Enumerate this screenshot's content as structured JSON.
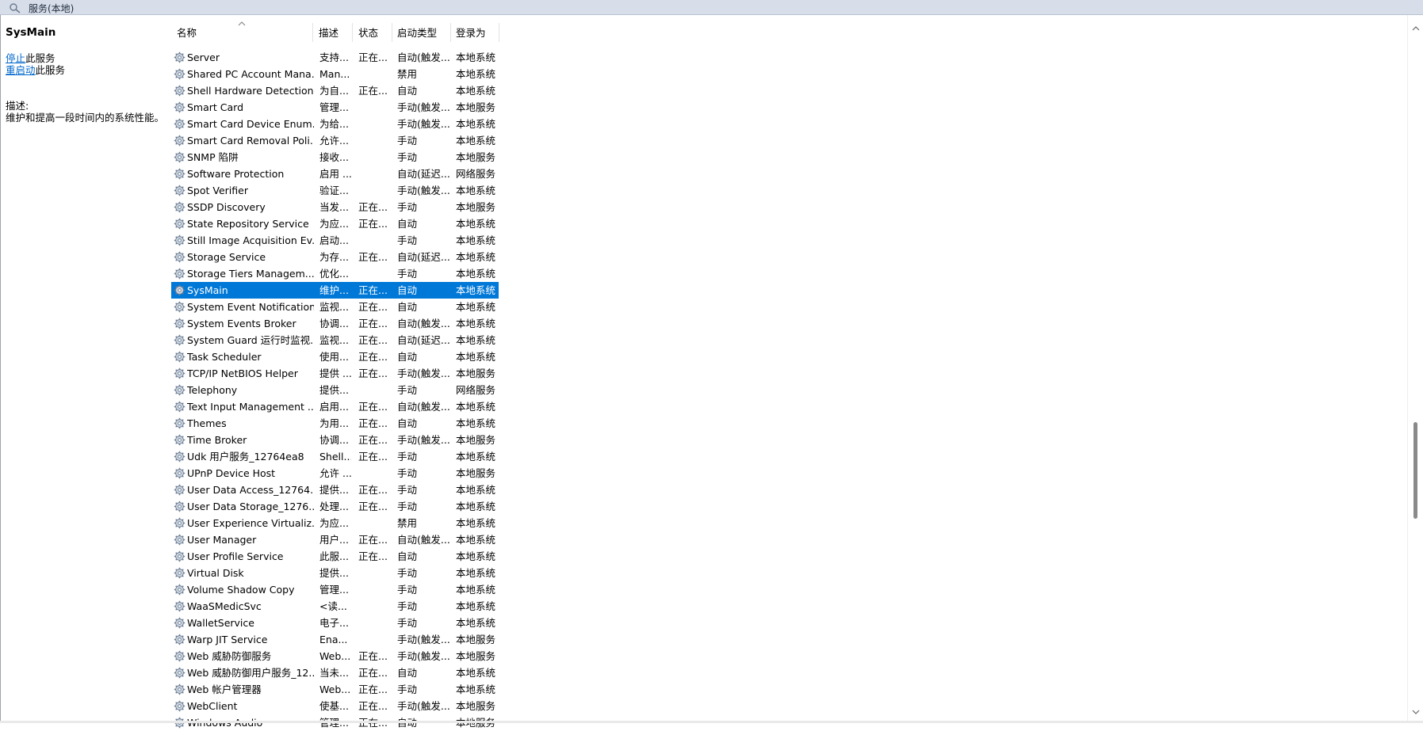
{
  "window": {
    "title": "服务(本地)",
    "icon": "services-icon"
  },
  "sidebar": {
    "service_name": "SysMain",
    "stop_link": "停止",
    "stop_suffix": "此服务",
    "restart_link": "重启动",
    "restart_suffix": "此服务",
    "desc_label": "描述:",
    "desc_text": "维护和提高一段时间内的系统性能。"
  },
  "table": {
    "columns": [
      "名称",
      "描述",
      "状态",
      "启动类型",
      "登录为"
    ],
    "sorted_column": "名称",
    "sort_direction": "ascending",
    "selected_row": "SysMain",
    "rows": [
      {
        "name": "Server",
        "desc": "支持...",
        "status": "正在...",
        "start": "自动(触发...",
        "logon": "本地系统"
      },
      {
        "name": "Shared PC Account Mana...",
        "desc": "Man...",
        "status": "",
        "start": "禁用",
        "logon": "本地系统"
      },
      {
        "name": "Shell Hardware Detection",
        "desc": "为自...",
        "status": "正在...",
        "start": "自动",
        "logon": "本地系统"
      },
      {
        "name": "Smart Card",
        "desc": "管理...",
        "status": "",
        "start": "手动(触发...",
        "logon": "本地服务"
      },
      {
        "name": "Smart Card Device Enum...",
        "desc": "为给...",
        "status": "",
        "start": "手动(触发...",
        "logon": "本地系统"
      },
      {
        "name": "Smart Card Removal Poli...",
        "desc": "允许...",
        "status": "",
        "start": "手动",
        "logon": "本地系统"
      },
      {
        "name": "SNMP 陷阱",
        "desc": "接收...",
        "status": "",
        "start": "手动",
        "logon": "本地服务"
      },
      {
        "name": "Software Protection",
        "desc": "启用 ...",
        "status": "",
        "start": "自动(延迟...",
        "logon": "网络服务"
      },
      {
        "name": "Spot Verifier",
        "desc": "验证...",
        "status": "",
        "start": "手动(触发...",
        "logon": "本地系统"
      },
      {
        "name": "SSDP Discovery",
        "desc": "当发...",
        "status": "正在...",
        "start": "手动",
        "logon": "本地服务"
      },
      {
        "name": "State Repository Service",
        "desc": "为应...",
        "status": "正在...",
        "start": "自动",
        "logon": "本地系统"
      },
      {
        "name": "Still Image Acquisition Ev...",
        "desc": "启动...",
        "status": "",
        "start": "手动",
        "logon": "本地系统"
      },
      {
        "name": "Storage Service",
        "desc": "为存...",
        "status": "正在...",
        "start": "自动(延迟...",
        "logon": "本地系统"
      },
      {
        "name": "Storage Tiers Managem...",
        "desc": "优化...",
        "status": "",
        "start": "手动",
        "logon": "本地系统"
      },
      {
        "name": "SysMain",
        "desc": "维护...",
        "status": "正在...",
        "start": "自动",
        "logon": "本地系统"
      },
      {
        "name": "System Event Notification...",
        "desc": "监视...",
        "status": "正在...",
        "start": "自动",
        "logon": "本地系统"
      },
      {
        "name": "System Events Broker",
        "desc": "协调...",
        "status": "正在...",
        "start": "自动(触发...",
        "logon": "本地系统"
      },
      {
        "name": "System Guard 运行时监视...",
        "desc": "监视...",
        "status": "正在...",
        "start": "自动(延迟...",
        "logon": "本地系统"
      },
      {
        "name": "Task Scheduler",
        "desc": "使用...",
        "status": "正在...",
        "start": "自动",
        "logon": "本地系统"
      },
      {
        "name": "TCP/IP NetBIOS Helper",
        "desc": "提供 ...",
        "status": "正在...",
        "start": "手动(触发...",
        "logon": "本地服务"
      },
      {
        "name": "Telephony",
        "desc": "提供...",
        "status": "",
        "start": "手动",
        "logon": "网络服务"
      },
      {
        "name": "Text Input Management ...",
        "desc": "启用...",
        "status": "正在...",
        "start": "自动(触发...",
        "logon": "本地系统"
      },
      {
        "name": "Themes",
        "desc": "为用...",
        "status": "正在...",
        "start": "自动",
        "logon": "本地系统"
      },
      {
        "name": "Time Broker",
        "desc": "协调...",
        "status": "正在...",
        "start": "手动(触发...",
        "logon": "本地服务"
      },
      {
        "name": "Udk 用户服务_12764ea8",
        "desc": "Shell...",
        "status": "正在...",
        "start": "手动",
        "logon": "本地系统"
      },
      {
        "name": "UPnP Device Host",
        "desc": "允许 ...",
        "status": "",
        "start": "手动",
        "logon": "本地服务"
      },
      {
        "name": "User Data Access_12764...",
        "desc": "提供...",
        "status": "正在...",
        "start": "手动",
        "logon": "本地系统"
      },
      {
        "name": "User Data Storage_1276...",
        "desc": "处理...",
        "status": "正在...",
        "start": "手动",
        "logon": "本地系统"
      },
      {
        "name": "User Experience Virtualiz...",
        "desc": "为应...",
        "status": "",
        "start": "禁用",
        "logon": "本地系统"
      },
      {
        "name": "User Manager",
        "desc": "用户...",
        "status": "正在...",
        "start": "自动(触发...",
        "logon": "本地系统"
      },
      {
        "name": "User Profile Service",
        "desc": "此服...",
        "status": "正在...",
        "start": "自动",
        "logon": "本地系统"
      },
      {
        "name": "Virtual Disk",
        "desc": "提供...",
        "status": "",
        "start": "手动",
        "logon": "本地系统"
      },
      {
        "name": "Volume Shadow Copy",
        "desc": "管理...",
        "status": "",
        "start": "手动",
        "logon": "本地系统"
      },
      {
        "name": "WaaSMedicSvc",
        "desc": "<读...",
        "status": "",
        "start": "手动",
        "logon": "本地系统"
      },
      {
        "name": "WalletService",
        "desc": "电子...",
        "status": "",
        "start": "手动",
        "logon": "本地系统"
      },
      {
        "name": "Warp JIT Service",
        "desc": "Ena...",
        "status": "",
        "start": "手动(触发...",
        "logon": "本地服务"
      },
      {
        "name": "Web 威胁防御服务",
        "desc": "Web...",
        "status": "正在...",
        "start": "手动(触发...",
        "logon": "本地服务"
      },
      {
        "name": "Web 威胁防御用户服务_12...",
        "desc": "当未...",
        "status": "正在...",
        "start": "自动",
        "logon": "本地系统"
      },
      {
        "name": "Web 帐户管理器",
        "desc": "Web...",
        "status": "正在...",
        "start": "手动",
        "logon": "本地系统"
      },
      {
        "name": "WebClient",
        "desc": "使基...",
        "status": "正在...",
        "start": "手动(触发...",
        "logon": "本地服务"
      },
      {
        "name": "Windows Audio",
        "desc": "管理...",
        "status": "正在...",
        "start": "自动",
        "logon": "本地服务"
      }
    ]
  },
  "scrollbar": {
    "position_fraction": 0.56,
    "visible_fraction": 0.14
  },
  "colors": {
    "selection": "#0078d7",
    "link": "#0066cc",
    "titlebar": "#d7dee9"
  }
}
